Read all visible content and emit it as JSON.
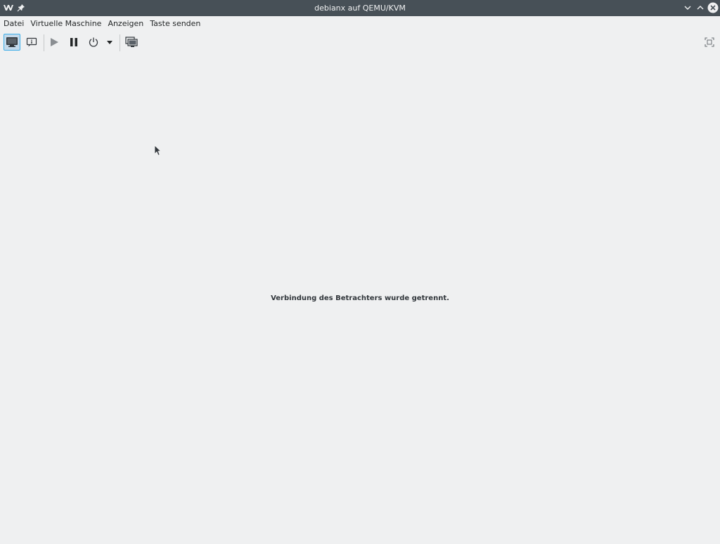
{
  "window": {
    "title": "debianx auf QEMU/KVM"
  },
  "menubar": {
    "items": [
      {
        "label": "Datei"
      },
      {
        "label": "Virtuelle Maschine"
      },
      {
        "label": "Anzeigen"
      },
      {
        "label": "Taste senden"
      }
    ]
  },
  "toolbar": {
    "buttons": [
      {
        "icon": "monitor-icon",
        "active": true
      },
      {
        "icon": "details-icon",
        "active": false
      },
      {
        "icon": "play-icon",
        "active": false
      },
      {
        "icon": "pause-icon",
        "active": false
      },
      {
        "icon": "power-icon",
        "active": false
      },
      {
        "icon": "chevron-down-icon",
        "active": false
      },
      {
        "icon": "snapshots-icon",
        "active": false
      },
      {
        "icon": "fullscreen-icon",
        "active": false
      }
    ]
  },
  "content": {
    "message": "Verbindung des Betrachters wurde getrennt."
  },
  "colors": {
    "titlebar": "#475057",
    "background": "#eff0f1",
    "accent": "#3daee9"
  }
}
